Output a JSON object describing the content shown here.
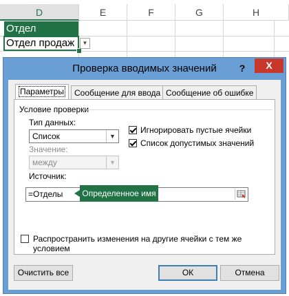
{
  "sheet": {
    "columns": [
      "D",
      "E",
      "F",
      "G",
      "H"
    ],
    "header_cell": "Отдел",
    "active_cell": "Отдел продаж"
  },
  "dialog": {
    "title": "Проверка вводимых значений",
    "help": "?",
    "close": "X",
    "tabs": [
      "Параметры",
      "Сообщение для ввода",
      "Сообщение об ошибке"
    ],
    "group_title": "Условие проверки",
    "data_type_label": "Тип данных:",
    "data_type_value": "Список",
    "value_label": "Значение:",
    "value_value": "между",
    "ignore_blank": {
      "label": "Игнорировать пустые ячейки",
      "checked": true
    },
    "in_cell_dropdown": {
      "label": "Список допустимых значений",
      "checked": true
    },
    "source_label": "Источник:",
    "source_value": "=Отделы",
    "apply_all": {
      "label": "Распространить изменения на другие ячейки с тем же условием",
      "checked": false
    },
    "clear_all": "Очистить все",
    "ok": "ОК",
    "cancel": "Отмена"
  },
  "callout": "Определенное имя",
  "colors": {
    "excel_green": "#217346",
    "title_bar": "#6a9fd6",
    "close_red": "#c8372c"
  }
}
